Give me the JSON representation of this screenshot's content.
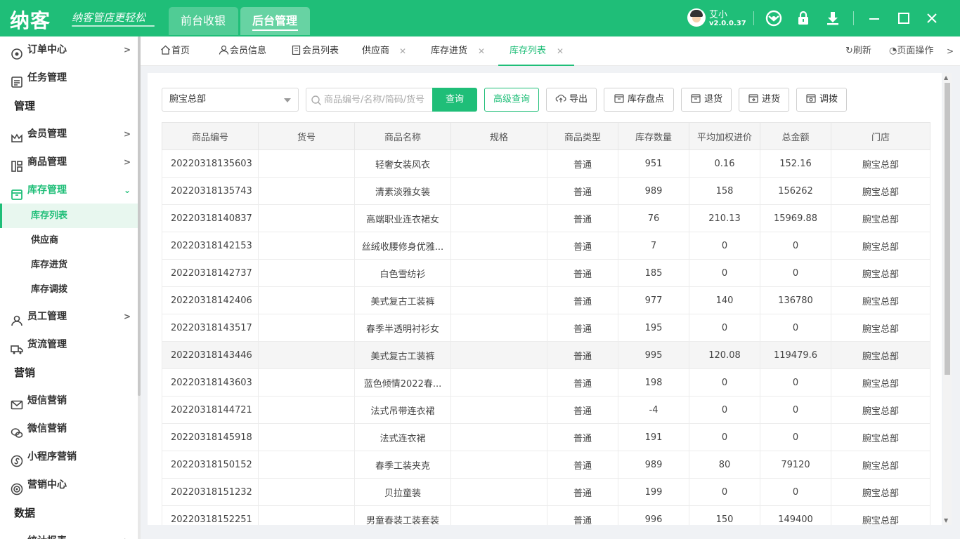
{
  "app": {
    "logo": "纳客",
    "slogan": "纳客管店更轻松",
    "top_tabs": [
      "前台收银",
      "后台管理"
    ],
    "user_name": "艾小",
    "version": "v2.0.0.37"
  },
  "sidebar": {
    "items": [
      {
        "label": "订单中心"
      },
      {
        "label": "任务管理"
      },
      {
        "header": "管理"
      },
      {
        "label": "会员管理"
      },
      {
        "label": "商品管理"
      },
      {
        "label": "库存管理"
      },
      {
        "sub": "库存列表"
      },
      {
        "sub": "供应商"
      },
      {
        "sub": "库存进货"
      },
      {
        "sub": "库存调拨"
      },
      {
        "label": "员工管理"
      },
      {
        "label": "货流管理"
      },
      {
        "header": "营销"
      },
      {
        "label": "短信营销"
      },
      {
        "label": "微信营销"
      },
      {
        "label": "小程序营销"
      },
      {
        "label": "营销中心"
      },
      {
        "header": "数据"
      },
      {
        "label": "统计报表"
      }
    ]
  },
  "tabs": [
    {
      "label": "首页"
    },
    {
      "label": "会员信息"
    },
    {
      "label": "会员列表"
    },
    {
      "label": "供应商"
    },
    {
      "label": "库存进货"
    },
    {
      "label": "库存列表"
    }
  ],
  "tab_tools": {
    "refresh": "刷新",
    "page_ops": "页面操作"
  },
  "toolbar": {
    "store_value": "腕宝总部",
    "search_placeholder": "商品编号/名称/简码/货号",
    "query": "查询",
    "advanced": "高级查询",
    "export": "导出",
    "stocktake": "库存盘点",
    "return": "退货",
    "purchase": "进货",
    "transfer": "调拨"
  },
  "table": {
    "columns": [
      "商品编号",
      "货号",
      "商品名称",
      "规格",
      "商品类型",
      "库存数量",
      "平均加权进价",
      "总金额",
      "门店"
    ],
    "rows": [
      [
        "20220318135603",
        "",
        "轻奢女装风衣",
        "",
        "普通",
        "951",
        "0.16",
        "152.16",
        "腕宝总部"
      ],
      [
        "20220318135743",
        "",
        "清素淡雅女装",
        "",
        "普通",
        "989",
        "158",
        "156262",
        "腕宝总部"
      ],
      [
        "20220318140837",
        "",
        "高端职业连衣裙女",
        "",
        "普通",
        "76",
        "210.13",
        "15969.88",
        "腕宝总部"
      ],
      [
        "20220318142153",
        "",
        "丝绒收腰修身优雅...",
        "",
        "普通",
        "7",
        "0",
        "0",
        "腕宝总部"
      ],
      [
        "20220318142737",
        "",
        "白色雪纺衫",
        "",
        "普通",
        "185",
        "0",
        "0",
        "腕宝总部"
      ],
      [
        "20220318142406",
        "",
        "美式复古工装裤",
        "",
        "普通",
        "977",
        "140",
        "136780",
        "腕宝总部"
      ],
      [
        "20220318143517",
        "",
        "春季半透明衬衫女",
        "",
        "普通",
        "195",
        "0",
        "0",
        "腕宝总部"
      ],
      [
        "20220318143446",
        "",
        "美式复古工装裤",
        "",
        "普通",
        "995",
        "120.08",
        "119479.6",
        "腕宝总部"
      ],
      [
        "20220318143603",
        "",
        "蓝色倾情2022春...",
        "",
        "普通",
        "198",
        "0",
        "0",
        "腕宝总部"
      ],
      [
        "20220318144721",
        "",
        "法式吊带连衣裙",
        "",
        "普通",
        "-4",
        "0",
        "0",
        "腕宝总部"
      ],
      [
        "20220318145918",
        "",
        "法式连衣裙",
        "",
        "普通",
        "191",
        "0",
        "0",
        "腕宝总部"
      ],
      [
        "20220318150152",
        "",
        "春季工装夹克",
        "",
        "普通",
        "989",
        "80",
        "79120",
        "腕宝总部"
      ],
      [
        "20220318151232",
        "",
        "贝拉童装",
        "",
        "普通",
        "199",
        "0",
        "0",
        "腕宝总部"
      ],
      [
        "20220318152251",
        "",
        "男童春装工装套装",
        "",
        "普通",
        "996",
        "150",
        "149400",
        "腕宝总部"
      ]
    ]
  },
  "colors": {
    "accent": "#1fbe78"
  }
}
